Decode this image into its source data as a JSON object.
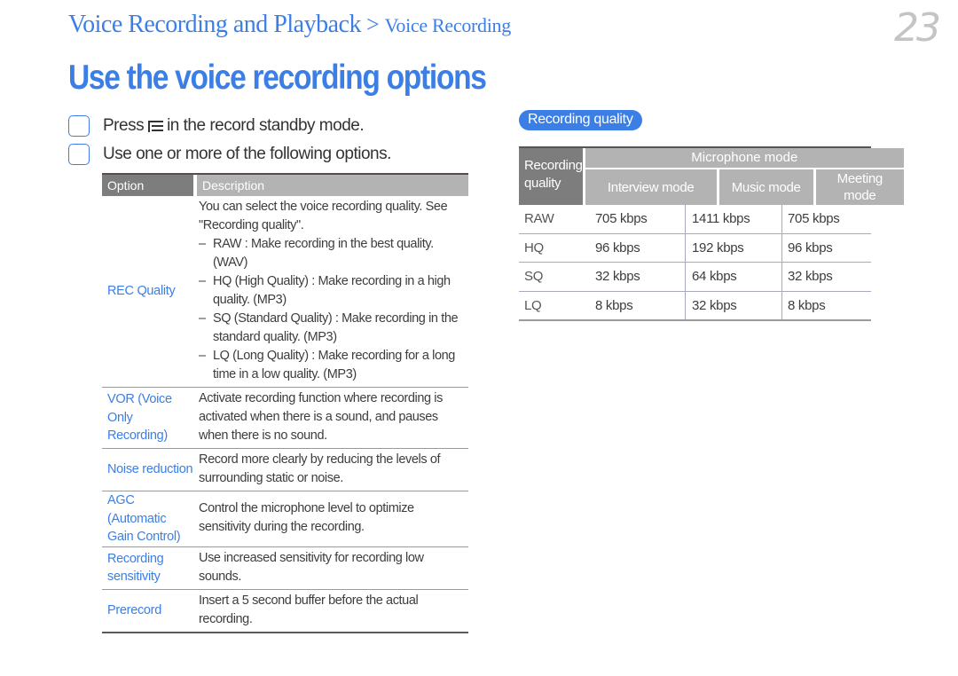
{
  "header": {
    "breadcrumb_main": "Voice Recording and Playback",
    "breadcrumb_separator": ">",
    "breadcrumb_sub": "Voice Recording",
    "page_number": "23"
  },
  "title": "Use the voice recording options",
  "steps": [
    {
      "before_icon": "Press",
      "icon": "menu-icon",
      "after_icon": "in the record standby mode."
    },
    {
      "text": "Use one or more of the following options."
    }
  ],
  "options_table": {
    "headers": [
      "Option",
      "Description"
    ],
    "rows": [
      {
        "option": "REC Quality",
        "description": "You can select the voice recording quality. See \"Recording quality\".",
        "bullets": [
          "RAW : Make recording in the best quality. (WAV)",
          "HQ (High Quality) : Make recording in a high quality. (MP3)",
          "SQ (Standard Quality) : Make recording in the standard quality. (MP3)",
          "LQ (Long Quality) : Make recording for a long time in a low quality. (MP3)"
        ]
      },
      {
        "option": "VOR (Voice Only Recording)",
        "description": "Activate recording function where recording is activated when there is a sound, and pauses when there is no sound."
      },
      {
        "option": "Noise reduction",
        "description": "Record more clearly by reducing the levels of surrounding static or noise."
      },
      {
        "option": "AGC (Automatic Gain Control)",
        "description": "Control the microphone level to optimize sensitivity during the recording."
      },
      {
        "option": "Recording sensitivity",
        "description": "Use increased sensitivity for recording low sounds."
      },
      {
        "option": "Prerecord",
        "description": "Insert a 5 second buffer before the actual recording."
      }
    ]
  },
  "recording_quality": {
    "badge": "Recording quality",
    "corner_header": "Recording quality",
    "group_header": "Microphone mode",
    "modes": [
      "Interview mode",
      "Music mode",
      "Meeting mode"
    ],
    "rows": [
      {
        "quality": "RAW",
        "values": [
          "705 kbps",
          "1411 kbps",
          "705 kbps"
        ]
      },
      {
        "quality": "HQ",
        "values": [
          "96 kbps",
          "192 kbps",
          "96 kbps"
        ]
      },
      {
        "quality": "SQ",
        "values": [
          "32 kbps",
          "64 kbps",
          "32 kbps"
        ]
      },
      {
        "quality": "LQ",
        "values": [
          "8 kbps",
          "32 kbps",
          "8 kbps"
        ]
      }
    ]
  },
  "colors": {
    "accent_blue": "#3b7fe6",
    "header_dark_gray": "#7d7d7d",
    "header_light_gray": "#b3b3b3",
    "page_number_gray": "#c4c4c4"
  }
}
